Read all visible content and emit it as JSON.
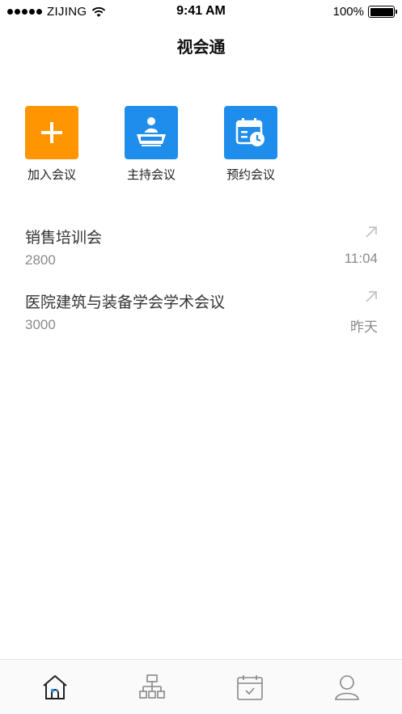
{
  "status_bar": {
    "carrier": "ZIJING",
    "time": "9:41 AM",
    "battery": "100%",
    "signal_bars": 5
  },
  "nav": {
    "title": "视会通"
  },
  "actions": [
    {
      "label": "加入会议",
      "icon": "plus-icon",
      "color": "#FF9500"
    },
    {
      "label": "主持会议",
      "icon": "host-icon",
      "color": "#1E8DEB"
    },
    {
      "label": "预约会议",
      "icon": "calendar-clock-icon",
      "color": "#1E8DEB"
    }
  ],
  "meetings": [
    {
      "title": "销售培训会",
      "id": "2800",
      "time": "11:04",
      "icon": "arrow-up-right-icon"
    },
    {
      "title": "医院建筑与装备学会学术会议",
      "id": "3000",
      "time": "昨天",
      "icon": "arrow-up-right-icon"
    }
  ],
  "tab_bar": {
    "tabs": [
      {
        "name": "home",
        "icon": "home-icon",
        "active": true
      },
      {
        "name": "contacts",
        "icon": "org-chart-icon",
        "active": false
      },
      {
        "name": "schedule",
        "icon": "calendar-check-icon",
        "active": false
      },
      {
        "name": "profile",
        "icon": "user-icon",
        "active": false
      }
    ]
  },
  "colors": {
    "accent_orange": "#FF9500",
    "accent_blue": "#1E8DEB",
    "secondary_text": "#8A8A8A"
  }
}
